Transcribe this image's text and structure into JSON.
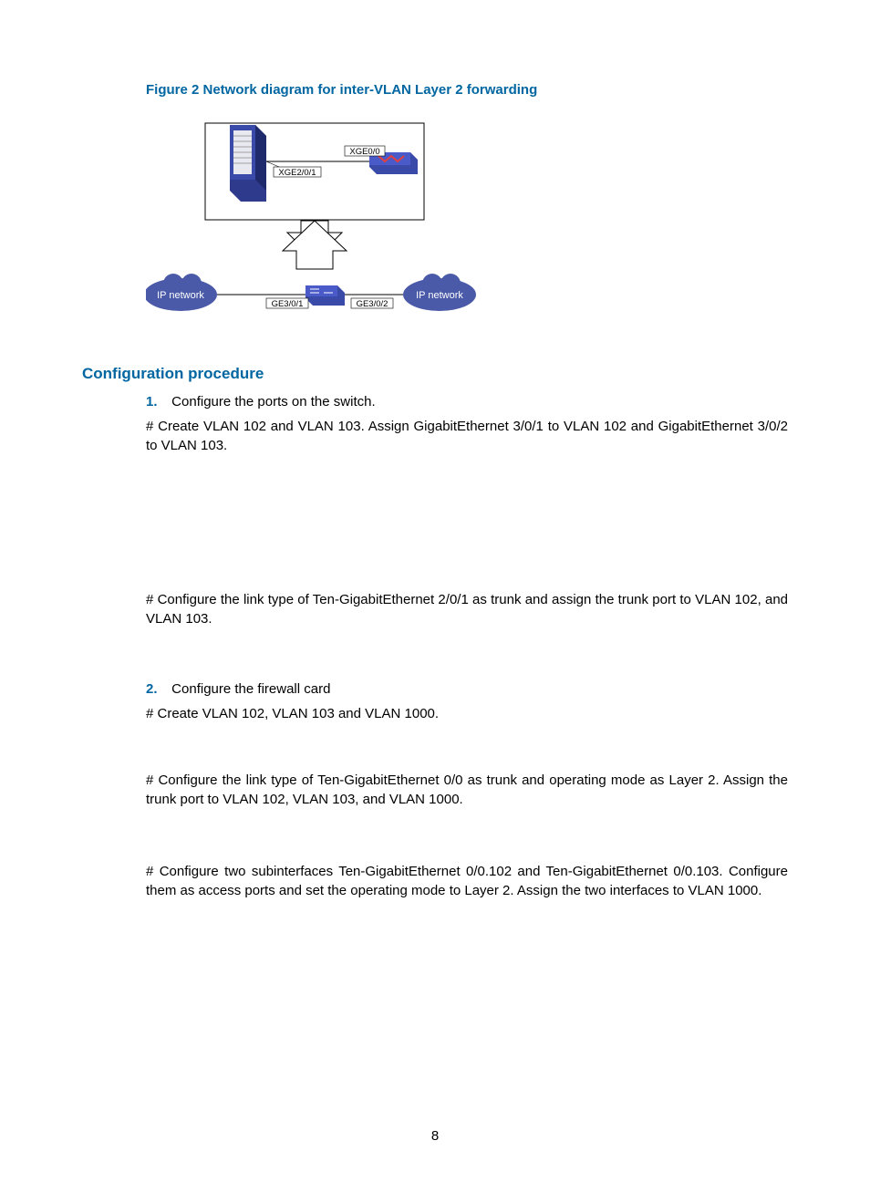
{
  "figure": {
    "caption": "Figure 2 Network diagram for inter-VLAN Layer 2 forwarding",
    "labels": {
      "xge00": "XGE0/0",
      "xge201": "XGE2/0/1",
      "ge301": "GE3/0/1",
      "ge302": "GE3/0/2",
      "ipnet_left": "IP network",
      "ipnet_right": "IP network"
    }
  },
  "heading": "Configuration procedure",
  "steps": {
    "s1": {
      "num": "1.",
      "text": "Configure the ports on the switch."
    },
    "s2": {
      "num": "2.",
      "text": "Configure the firewall card"
    }
  },
  "paras": {
    "p1": "# Create VLAN 102 and VLAN 103. Assign GigabitEthernet 3/0/1 to VLAN 102 and GigabitEthernet 3/0/2 to VLAN 103.",
    "p2": "# Configure the link type of Ten-GigabitEthernet 2/0/1 as trunk and assign the trunk port to VLAN 102, and VLAN 103.",
    "p3": "# Create VLAN 102, VLAN 103 and VLAN 1000.",
    "p4": "# Configure the link type of Ten-GigabitEthernet 0/0 as trunk and operating mode as Layer 2. Assign the trunk port to VLAN 102, VLAN 103, and VLAN 1000.",
    "p5": "# Configure two subinterfaces Ten-GigabitEthernet 0/0.102 and Ten-GigabitEthernet 0/0.103. Configure them as access ports and set the operating mode to Layer 2. Assign the two interfaces to VLAN 1000."
  },
  "page_number": "8"
}
